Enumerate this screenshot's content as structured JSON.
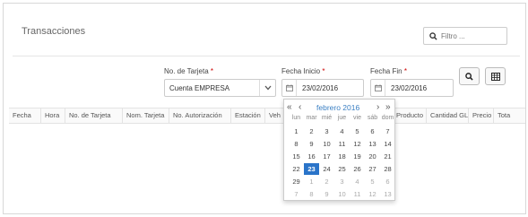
{
  "page": {
    "title": "Transacciones"
  },
  "filter": {
    "placeholder": "Filtro ..."
  },
  "form": {
    "card_label": "No. de Tarjeta",
    "card_value": "Cuenta EMPRESA",
    "start_label": "Fecha Inicio",
    "start_value": "23/02/2016",
    "end_label": "Fecha Fin",
    "end_value": "23/02/2016",
    "required_mark": "*"
  },
  "table": {
    "columns": [
      "Fecha",
      "Hora",
      "No. de Tarjeta",
      "Nom. Tarjeta",
      "No. Autorización",
      "Estación",
      "Veh",
      "Producto",
      "Cantidad GL",
      "Precio",
      "Tota"
    ]
  },
  "datepicker": {
    "prev_year": "«",
    "prev_month": "‹",
    "next_month": "›",
    "next_year": "»",
    "month_label": "febrero 2016",
    "weekdays": [
      "lun",
      "mar",
      "mié",
      "jue",
      "vie",
      "sáb",
      "dom"
    ],
    "weeks": [
      [
        "1",
        "2",
        "3",
        "4",
        "5",
        "6",
        "7"
      ],
      [
        "8",
        "9",
        "10",
        "11",
        "12",
        "13",
        "14"
      ],
      [
        "15",
        "16",
        "17",
        "18",
        "19",
        "20",
        "21"
      ],
      [
        "22",
        "23",
        "24",
        "25",
        "26",
        "27",
        "28"
      ],
      [
        "29",
        "1",
        "2",
        "3",
        "4",
        "5",
        "6"
      ],
      [
        "7",
        "8",
        "9",
        "10",
        "11",
        "12",
        "13"
      ]
    ],
    "selected_day": "23"
  },
  "icons": {
    "search": "search-icon",
    "chevron": "chevron-down-icon",
    "calendar": "calendar-icon",
    "grid": "grid-icon"
  },
  "colors": {
    "accent": "#2a74c9",
    "required": "#cc0000"
  }
}
